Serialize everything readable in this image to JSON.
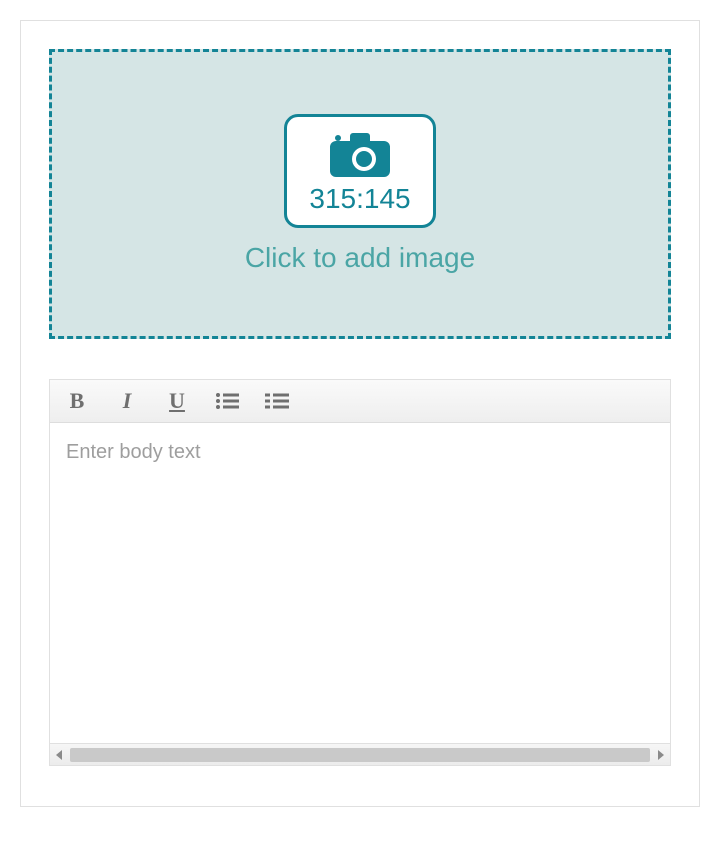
{
  "image_drop": {
    "ratio_label": "315:145",
    "prompt": "Click to add image"
  },
  "editor": {
    "toolbar": {
      "bold": "B",
      "italic": "I",
      "under": "U"
    },
    "placeholder": "Enter body text"
  }
}
